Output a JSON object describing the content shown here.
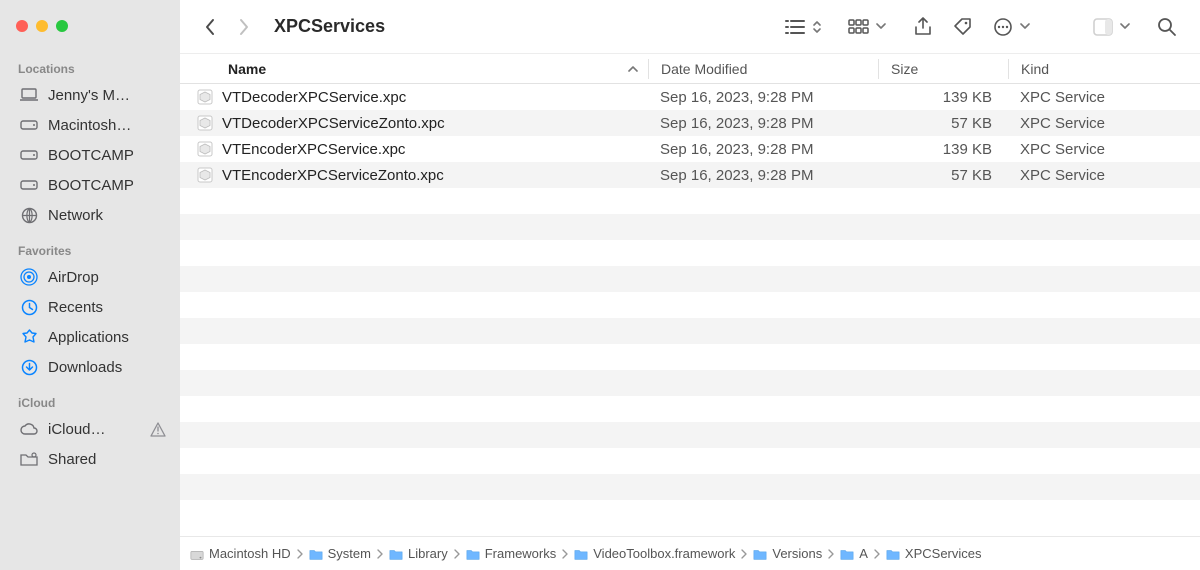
{
  "sidebar": {
    "sections": [
      {
        "heading": "Locations",
        "items": [
          {
            "icon": "laptop",
            "label": "Jenny's M…"
          },
          {
            "icon": "hdd",
            "label": "Macintosh…"
          },
          {
            "icon": "hdd",
            "label": "BOOTCAMP"
          },
          {
            "icon": "hdd",
            "label": "BOOTCAMP"
          },
          {
            "icon": "globe",
            "label": "Network"
          }
        ]
      },
      {
        "heading": "Favorites",
        "items": [
          {
            "icon": "airdrop",
            "label": "AirDrop",
            "blue": true
          },
          {
            "icon": "clock",
            "label": "Recents",
            "blue": true
          },
          {
            "icon": "apps",
            "label": "Applications",
            "blue": true
          },
          {
            "icon": "download",
            "label": "Downloads",
            "blue": true
          }
        ]
      },
      {
        "heading": "iCloud",
        "items": [
          {
            "icon": "cloud",
            "label": "iCloud…",
            "warn": true
          },
          {
            "icon": "shared",
            "label": "Shared"
          }
        ]
      }
    ]
  },
  "toolbar": {
    "title": "XPCServices"
  },
  "columns": {
    "name": "Name",
    "date": "Date Modified",
    "size": "Size",
    "kind": "Kind"
  },
  "files": [
    {
      "name": "VTDecoderXPCService.xpc",
      "date": "Sep 16, 2023, 9:28 PM",
      "size": "139 KB",
      "kind": "XPC Service"
    },
    {
      "name": "VTDecoderXPCServiceZonto.xpc",
      "date": "Sep 16, 2023, 9:28 PM",
      "size": "57 KB",
      "kind": "XPC Service"
    },
    {
      "name": "VTEncoderXPCService.xpc",
      "date": "Sep 16, 2023, 9:28 PM",
      "size": "139 KB",
      "kind": "XPC Service"
    },
    {
      "name": "VTEncoderXPCServiceZonto.xpc",
      "date": "Sep 16, 2023, 9:28 PM",
      "size": "57 KB",
      "kind": "XPC Service"
    }
  ],
  "path": [
    {
      "icon": "disk",
      "label": "Macintosh HD"
    },
    {
      "icon": "folder",
      "label": "System"
    },
    {
      "icon": "folder",
      "label": "Library"
    },
    {
      "icon": "folder",
      "label": "Frameworks"
    },
    {
      "icon": "folder",
      "label": "VideoToolbox.framework"
    },
    {
      "icon": "folder",
      "label": "Versions"
    },
    {
      "icon": "folder",
      "label": "A"
    },
    {
      "icon": "folder",
      "label": "XPCServices"
    }
  ]
}
